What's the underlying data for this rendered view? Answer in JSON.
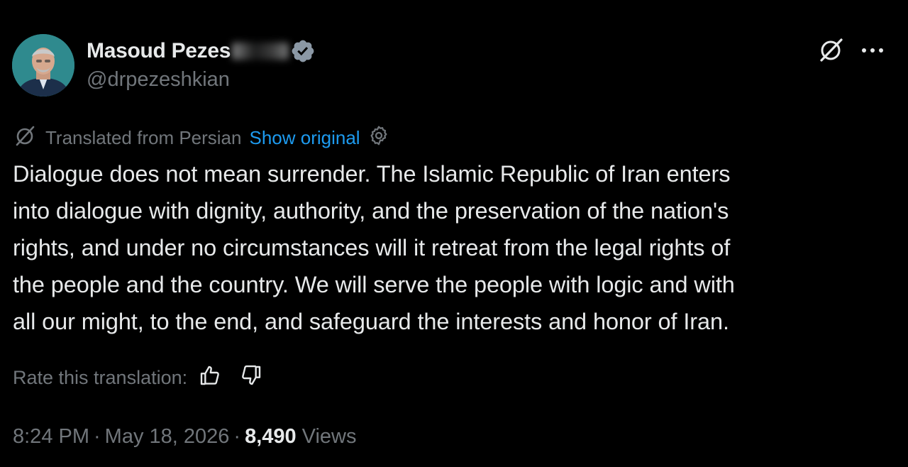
{
  "author": {
    "display_name": "Masoud Pezes",
    "handle": "@drpezeshkian",
    "avatar_icon": "person-avatar",
    "verified_icon": "verified-badge-icon",
    "verified_color": "#8b98a5"
  },
  "header_actions": {
    "grok_icon": "grok-icon",
    "more_icon": "more-options-icon"
  },
  "translation": {
    "label": "Translated from Persian",
    "show_original": "Show original",
    "settings_icon": "gear-icon",
    "link_color": "#1d9bf0"
  },
  "tweet": {
    "text": "Dialogue does not mean surrender. The Islamic Republic of Iran enters\ninto dialogue with dignity, authority, and the preservation of the nation's\nrights, and under no circumstances will it retreat from the legal rights of\nthe people and the country. We will serve the people with logic and with\nall our might, to the end, and safeguard the interests and honor of Iran."
  },
  "rating": {
    "label": "Rate this translation:",
    "thumbs_up_icon": "thumbs-up-icon",
    "thumbs_down_icon": "thumbs-down-icon"
  },
  "meta": {
    "time": "8:24 PM",
    "separator": "·",
    "date": "May 18, 2026",
    "views_count": "8,490",
    "views_label": "Views"
  },
  "colors": {
    "background": "#000000",
    "primary_text": "#e7e9ea",
    "secondary_text": "#71767b"
  }
}
